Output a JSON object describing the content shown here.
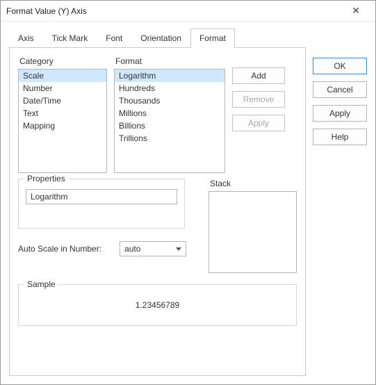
{
  "window": {
    "title": "Format Value (Y) Axis"
  },
  "tabs": {
    "axis": "Axis",
    "tick": "Tick Mark",
    "font": "Font",
    "orientation": "Orientation",
    "format": "Format"
  },
  "labels": {
    "category": "Category",
    "format": "Format",
    "properties": "Properties",
    "stack": "Stack",
    "autoscale": "Auto Scale in Number:",
    "sample": "Sample"
  },
  "category_items": {
    "scale": "Scale",
    "number": "Number",
    "datetime": "Date/Time",
    "text": "Text",
    "mapping": "Mapping"
  },
  "format_items": {
    "logarithm": "Logarithm",
    "hundreds": "Hundreds",
    "thousands": "Thousands",
    "millions": "Millions",
    "billions": "Billions",
    "trillions": "Trillions"
  },
  "mini_buttons": {
    "add": "Add",
    "remove": "Remove",
    "apply": "Apply"
  },
  "properties_value": "Logarithm",
  "autoscale_value": "auto",
  "sample_value": "1.23456789",
  "side_buttons": {
    "ok": "OK",
    "cancel": "Cancel",
    "apply": "Apply",
    "help": "Help"
  }
}
